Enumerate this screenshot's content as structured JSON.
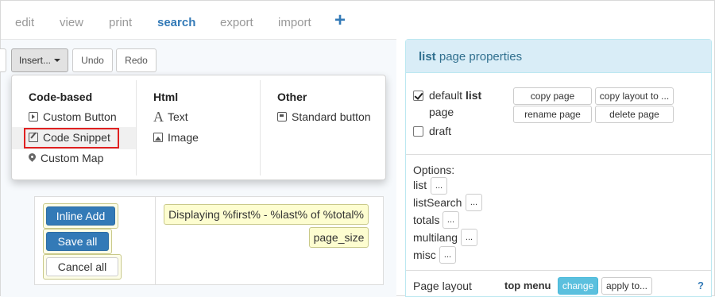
{
  "nav": {
    "tabs": [
      {
        "label": "edit",
        "active": false
      },
      {
        "label": "view",
        "active": false
      },
      {
        "label": "print",
        "active": false
      },
      {
        "label": "search",
        "active": true
      },
      {
        "label": "export",
        "active": false
      },
      {
        "label": "import",
        "active": false
      }
    ],
    "add_symbol": "+"
  },
  "toolbar": {
    "insert_label": "Insert...",
    "undo_label": "Undo",
    "redo_label": "Redo"
  },
  "insert_menu": {
    "columns": [
      {
        "heading": "Code-based",
        "items": [
          {
            "label": "Custom Button",
            "icon": "play-square-icon"
          },
          {
            "label": "Code Snippet",
            "icon": "edit-icon",
            "highlighted": true
          },
          {
            "label": "Custom Map",
            "icon": "map-marker-icon"
          }
        ]
      },
      {
        "heading": "Html",
        "items": [
          {
            "label": "Text",
            "icon": "font-icon"
          },
          {
            "label": "Image",
            "icon": "picture-icon"
          }
        ]
      },
      {
        "heading": "Other",
        "items": [
          {
            "label": "Standard button",
            "icon": "button-icon"
          }
        ]
      }
    ]
  },
  "grid": {
    "buttons": {
      "inline_add": "Inline Add",
      "save_all": "Save all",
      "cancel_all": "Cancel all"
    },
    "record_info": "Displaying %first% - %last% of %total%",
    "page_size": "page_size"
  },
  "properties": {
    "title_bold": "list",
    "title_rest": "page properties",
    "default_label_prefix": "default",
    "default_label_bold": "list",
    "default_label_suffix": "page",
    "default_checked": true,
    "draft_label": "draft",
    "draft_checked": false,
    "copy_page": "copy page",
    "copy_layout": "copy layout to ...",
    "rename_page": "rename page",
    "delete_page": "delete page",
    "options_label": "Options:",
    "options": [
      {
        "label": "list",
        "button": "..."
      },
      {
        "label": "listSearch",
        "button": "..."
      },
      {
        "label": "totals",
        "button": "..."
      },
      {
        "label": "multilang",
        "button": "..."
      },
      {
        "label": "misc",
        "button": "..."
      }
    ],
    "layout_label": "Page layout",
    "layout_value": "top menu",
    "change_label": "change",
    "apply_label": "apply to...",
    "help_symbol": "?"
  },
  "colors": {
    "accent": "#337ab7",
    "panel_header": "#d9edf7",
    "highlight_border": "#e02020",
    "change_button": "#5bc0de"
  }
}
